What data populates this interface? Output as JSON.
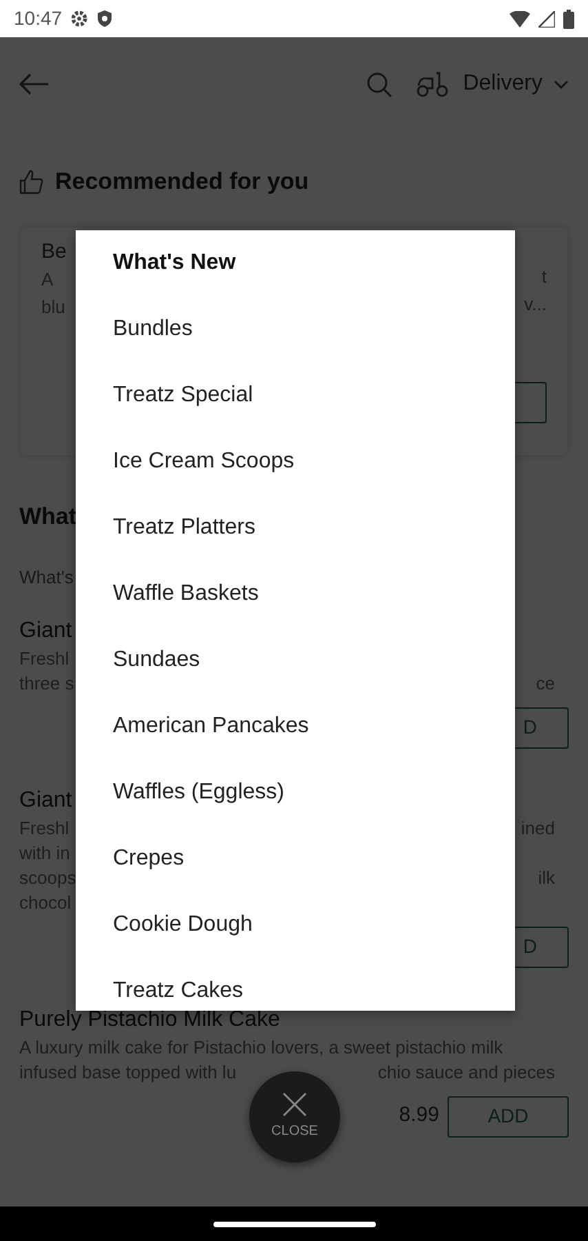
{
  "status_bar": {
    "time": "10:47"
  },
  "header": {
    "delivery_label": "Delivery"
  },
  "recommended": {
    "title": "Recommended for you",
    "card_left": [
      "Be",
      "A",
      "blu"
    ],
    "card_right": [
      "t",
      "v..."
    ]
  },
  "section": {
    "heading": "What",
    "subheading": "What's"
  },
  "products": [
    {
      "name": "Giant",
      "lines": [
        {
          "left": "Freshl"
        },
        {
          "left": "three s",
          "right": "ce"
        }
      ],
      "add": "D"
    },
    {
      "name": "Giant",
      "lines": [
        {
          "left": "Freshl",
          "right": "ined"
        },
        {
          "left": "with in"
        },
        {
          "left": "scoops",
          "right": "ilk"
        },
        {
          "left": "chocol"
        }
      ],
      "add": "D"
    },
    {
      "name": "Purely Pistachio Milk Cake",
      "lines": [
        {
          "left": "A luxury milk cake for Pistachio lovers, a sweet pistachio milk"
        },
        {
          "left": "infused base topped with lu",
          "right": "chio sauce and pieces"
        }
      ],
      "price": "8.99",
      "add": "ADD"
    }
  ],
  "menu": {
    "items": [
      {
        "label": "What's New",
        "selected": true
      },
      {
        "label": "Bundles",
        "selected": false
      },
      {
        "label": "Treatz Special",
        "selected": false
      },
      {
        "label": "Ice Cream Scoops",
        "selected": false
      },
      {
        "label": "Treatz Platters",
        "selected": false
      },
      {
        "label": "Waffle Baskets",
        "selected": false
      },
      {
        "label": "Sundaes",
        "selected": false
      },
      {
        "label": "American Pancakes",
        "selected": false
      },
      {
        "label": "Waffles (Eggless)",
        "selected": false
      },
      {
        "label": "Crepes",
        "selected": false
      },
      {
        "label": "Cookie Dough",
        "selected": false
      },
      {
        "label": "Treatz Cakes",
        "selected": false
      }
    ]
  },
  "close_button": {
    "label": "CLOSE"
  }
}
